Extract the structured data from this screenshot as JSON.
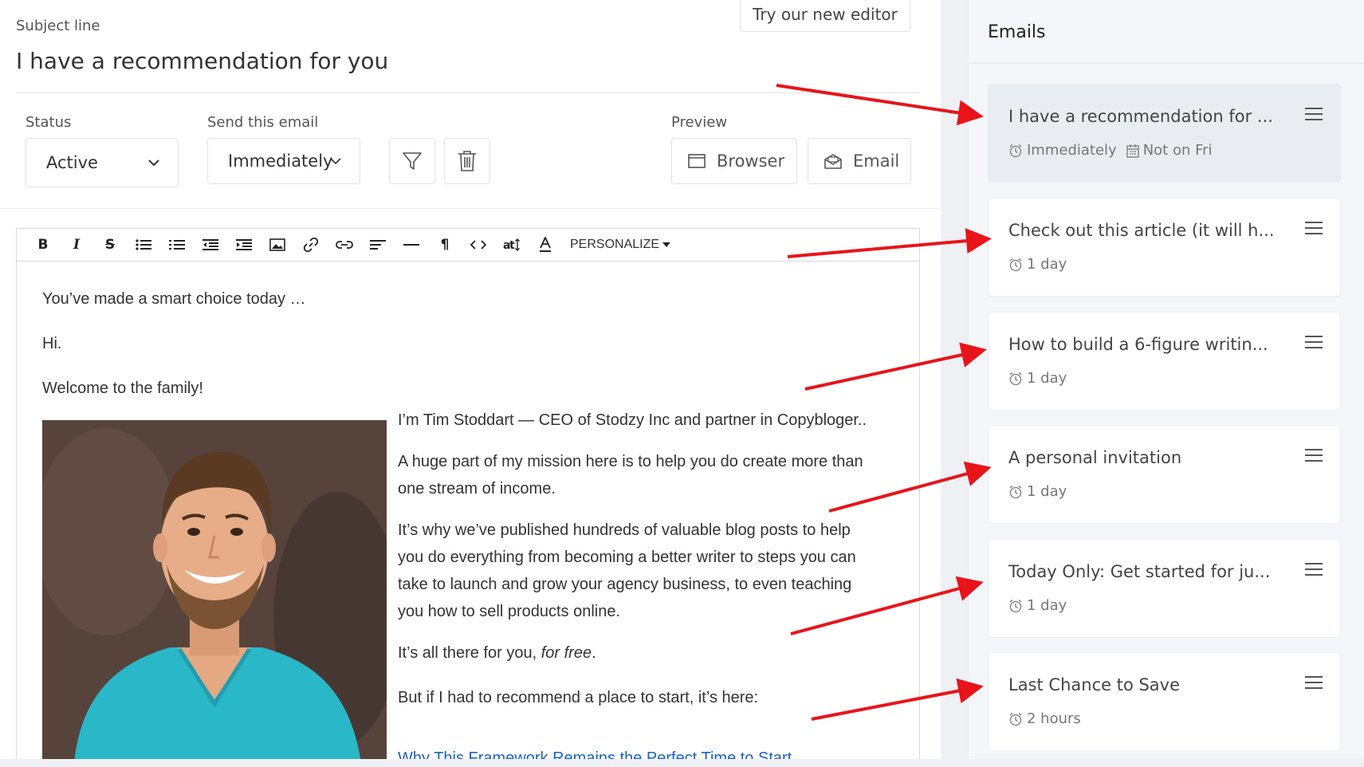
{
  "subject": {
    "label": "Subject line",
    "value": "I have a recommendation for you"
  },
  "try_new_editor": "Try our new editor",
  "status": {
    "label": "Status",
    "value": "Active"
  },
  "send": {
    "label": "Send this email",
    "value": "Immediately"
  },
  "preview": {
    "label": "Preview",
    "browser": "Browser",
    "email": "Email"
  },
  "toolbar": {
    "personalize": "PERSONALIZE",
    "buttons": [
      "bold-icon",
      "italic-icon",
      "strikethrough-icon",
      "bullet-list-icon",
      "numbered-list-icon",
      "outdent-icon",
      "indent-icon",
      "image-icon",
      "link-icon",
      "unlink-icon",
      "align-icon",
      "horizontal-rule-icon",
      "paragraph-icon",
      "code-icon",
      "text-size-icon",
      "text-color-icon"
    ]
  },
  "body": {
    "p1": "You’ve made a smart choice today …",
    "p2": "Hi.",
    "p3": "Welcome to the family!",
    "p4": "I’m Tim Stoddart — CEO of Stodzy Inc and partner in Copybloger..",
    "p5_line1": "A huge part of my mission here is to help you do create more than",
    "p5_line2": "one stream of income.",
    "p6_line1": "It’s why we’ve published hundreds of valuable blog posts to help",
    "p6_line2": "you do everything from becoming a better writer to steps you can",
    "p6_line3": "take to launch and grow your agency business, to even teaching",
    "p6_line4": "you how to sell products online.",
    "p7_text": "It’s all there for you, ",
    "p7_emph": "for free",
    "p7_end": ".",
    "p8": "But if I had to recommend a place to start, it’s here:",
    "link_cut": "Why This Framework Remains the Perfect Time to Start"
  },
  "emails": {
    "title": "Emails",
    "items": [
      {
        "title": "I have a recommendation for ...",
        "delay": "Immediately",
        "days": "Not on Fri",
        "active": true
      },
      {
        "title": "Check out this article (it will h...",
        "delay": "1 day"
      },
      {
        "title": "How to build a 6-figure writin...",
        "delay": "1 day"
      },
      {
        "title": "A personal invitation",
        "delay": "1 day"
      },
      {
        "title": "Today Only: Get started for ju...",
        "delay": "1 day"
      },
      {
        "title": "Last Chance to Save",
        "delay": "2 hours"
      }
    ]
  },
  "colors": {
    "arrow": "#e8141a",
    "link": "#1a63c6",
    "active_card": "#e9ecf1",
    "shirt": "#2ab7c8"
  }
}
